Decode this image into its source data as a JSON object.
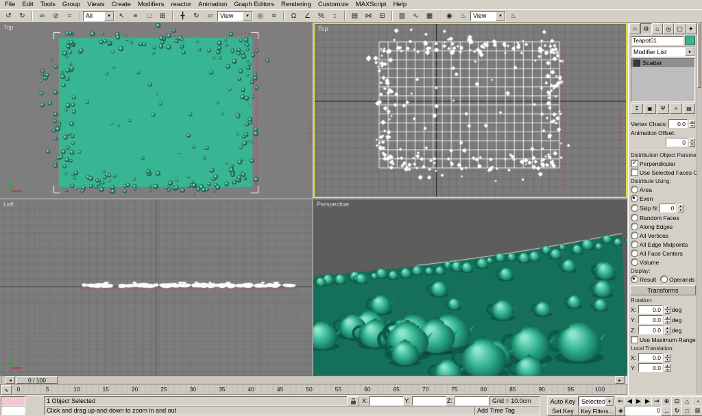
{
  "colors": {
    "active_viewport_border": "#dfdb4a",
    "object_color": "#38b694",
    "teapot_fill": "#2fae8d",
    "ground_fill": "#147059",
    "selection_red": "#cc3333"
  },
  "menu": {
    "items": [
      "File",
      "Edit",
      "Tools",
      "Group",
      "Views",
      "Create",
      "Modifiers",
      "reactor",
      "Animation",
      "Graph Editors",
      "Rendering",
      "Customize",
      "MAXScript",
      "Help"
    ]
  },
  "toolbar": {
    "selection_filter": "All",
    "reference_coordinate_system": "View",
    "render_type": "View",
    "buttons": [
      {
        "name": "undo",
        "glyph": "↺"
      },
      {
        "name": "redo",
        "glyph": "↻"
      },
      {
        "name": "select-and-link",
        "glyph": "∞"
      },
      {
        "name": "unlink-selection",
        "glyph": "⊘"
      },
      {
        "name": "bind-to-space-warp",
        "glyph": "≈"
      },
      {
        "name": "select-object",
        "glyph": "↖"
      },
      {
        "name": "select-by-name",
        "glyph": "≡"
      },
      {
        "name": "rectangular-selection-region",
        "glyph": "□"
      },
      {
        "name": "window-crossing-toggle",
        "glyph": "⊞"
      },
      {
        "name": "select-and-move",
        "glyph": "╋"
      },
      {
        "name": "select-and-rotate",
        "glyph": "↻"
      },
      {
        "name": "select-and-uniform-scale",
        "glyph": "▱"
      },
      {
        "name": "use-pivot-point-center",
        "glyph": "◎"
      },
      {
        "name": "select-and-manipulate",
        "glyph": "¤"
      },
      {
        "name": "snaps-toggle",
        "glyph": "Ω"
      },
      {
        "name": "angle-snap-toggle",
        "glyph": "∠"
      },
      {
        "name": "percent-snap-toggle",
        "glyph": "%"
      },
      {
        "name": "spinner-snap-toggle",
        "glyph": "↕"
      },
      {
        "name": "edit-named-selection-sets",
        "glyph": "▤"
      },
      {
        "name": "mirror",
        "glyph": "⋈"
      },
      {
        "name": "align",
        "glyph": "⊟"
      },
      {
        "name": "layer-manager",
        "glyph": "▥"
      },
      {
        "name": "curve-editor",
        "glyph": "∿"
      },
      {
        "name": "schematic-view",
        "glyph": "▦"
      },
      {
        "name": "material-editor",
        "glyph": "◉"
      },
      {
        "name": "render-scene-dialog",
        "glyph": "♨"
      },
      {
        "name": "quick-render",
        "glyph": "♨"
      }
    ]
  },
  "viewports": {
    "top_left_label": "Top",
    "top_right_label": "Top",
    "bottom_left_label": "Left",
    "bottom_right_label": "Perspective"
  },
  "command_panel": {
    "tabs": [
      {
        "name": "create",
        "glyph": "☆"
      },
      {
        "name": "modify",
        "glyph": "⚙"
      },
      {
        "name": "hierarchy",
        "glyph": "⌂"
      },
      {
        "name": "motion",
        "glyph": "◎"
      },
      {
        "name": "display",
        "glyph": "▢"
      },
      {
        "name": "utilities",
        "glyph": "✦"
      }
    ],
    "object_name": "Teapot01",
    "modifier_list_label": "Modifier List",
    "stack_items": [
      {
        "label": "Scatter"
      }
    ],
    "stack_tools": [
      {
        "name": "pin-stack",
        "glyph": "↧"
      },
      {
        "name": "show-end-result",
        "glyph": "▣"
      },
      {
        "name": "make-unique",
        "glyph": "Ψ"
      },
      {
        "name": "remove-modifier",
        "glyph": "×"
      },
      {
        "name": "configure-modifier-sets",
        "glyph": "▤"
      }
    ],
    "params": {
      "vertex_chaos_label": "Vertex Chaos:",
      "vertex_chaos_value": "0.0",
      "animation_offset_label": "Animation Offset:",
      "animation_offset_value": "0",
      "distribution_group_title": "Distribution Object Parameters:",
      "perpendicular_label": "Perpendicular",
      "use_selected_faces_label": "Use Selected Faces Only",
      "distribute_using_label": "Distribute Using:",
      "distribute_options": [
        {
          "label": "Area",
          "selected": false
        },
        {
          "label": "Even",
          "selected": true
        },
        {
          "label": "Skip N:",
          "selected": false,
          "value": "0"
        },
        {
          "label": "Random Faces",
          "selected": false
        },
        {
          "label": "Along Edges",
          "selected": false
        },
        {
          "label": "All Vertices",
          "selected": false
        },
        {
          "label": "All Edge Midpoints",
          "selected": false
        },
        {
          "label": "All Face Centers",
          "selected": false
        },
        {
          "label": "Volume",
          "selected": false
        }
      ],
      "display_label": "Display:",
      "display_options": [
        {
          "label": "Result",
          "selected": true
        },
        {
          "label": "Operands",
          "selected": false
        }
      ],
      "transforms_rollout_title": "Transforms",
      "rotation_label": "Rotation:",
      "rotation_rows": [
        {
          "axis": "X:",
          "value": "0.0",
          "unit": "deg"
        },
        {
          "axis": "Y:",
          "value": "0.0",
          "unit": "deg"
        },
        {
          "axis": "Z:",
          "value": "0.0",
          "unit": "deg"
        }
      ],
      "use_maximum_range_label": "Use Maximum Range",
      "local_translation_label": "Local Translation:",
      "local_translation_rows": [
        {
          "axis": "X:",
          "value": "0.0"
        },
        {
          "axis": "Y:",
          "value": "0.0"
        }
      ]
    }
  },
  "timeline": {
    "slider_label": "0 / 100",
    "left_arrow": "◂",
    "right_arrow": "▸",
    "ticks": [
      0,
      5,
      10,
      15,
      20,
      25,
      30,
      35,
      40,
      45,
      50,
      55,
      60,
      65,
      70,
      75,
      80,
      85,
      90,
      95,
      100
    ]
  },
  "status": {
    "selection_text": "1 Object Selected",
    "x_label": "X:",
    "y_label": "Y:",
    "z_label": "Z:",
    "x_value": "",
    "y_value": "",
    "z_value": "",
    "grid_text": "Grid = 10.0cm",
    "add_time_tag": "Add Time Tag",
    "prompt": "Click and drag up-and-down to zoom in and out",
    "auto_key": "Auto Key",
    "set_key": "Set Key",
    "key_mode": "Selected",
    "key_filters": "Key Filters..."
  },
  "transport": {
    "frame_value": "0",
    "key_mode_glyph": "◈",
    "buttons": [
      {
        "name": "go-to-start",
        "glyph": "⇤"
      },
      {
        "name": "previous-frame",
        "glyph": "◀"
      },
      {
        "name": "play",
        "glyph": "▶"
      },
      {
        "name": "next-frame",
        "glyph": "▶"
      },
      {
        "name": "go-to-end",
        "glyph": "⇥"
      }
    ]
  },
  "nav": {
    "buttons": [
      {
        "name": "zoom",
        "glyph": "⊕"
      },
      {
        "name": "zoom-all",
        "glyph": "⊡"
      },
      {
        "name": "zoom-extents",
        "glyph": "⌂"
      },
      {
        "name": "field-of-view",
        "glyph": "◔"
      },
      {
        "name": "pan",
        "glyph": "↔"
      },
      {
        "name": "arc-rotate",
        "glyph": "↻"
      },
      {
        "name": "region-zoom",
        "glyph": "□"
      },
      {
        "name": "min-max-toggle",
        "glyph": "⊠"
      }
    ]
  },
  "ui": {
    "dropdown_arrow": "▾",
    "spinner_up": "▴",
    "spinner_down": "▾",
    "check_mark": "✓",
    "mini_curve_glyph": "∿"
  }
}
